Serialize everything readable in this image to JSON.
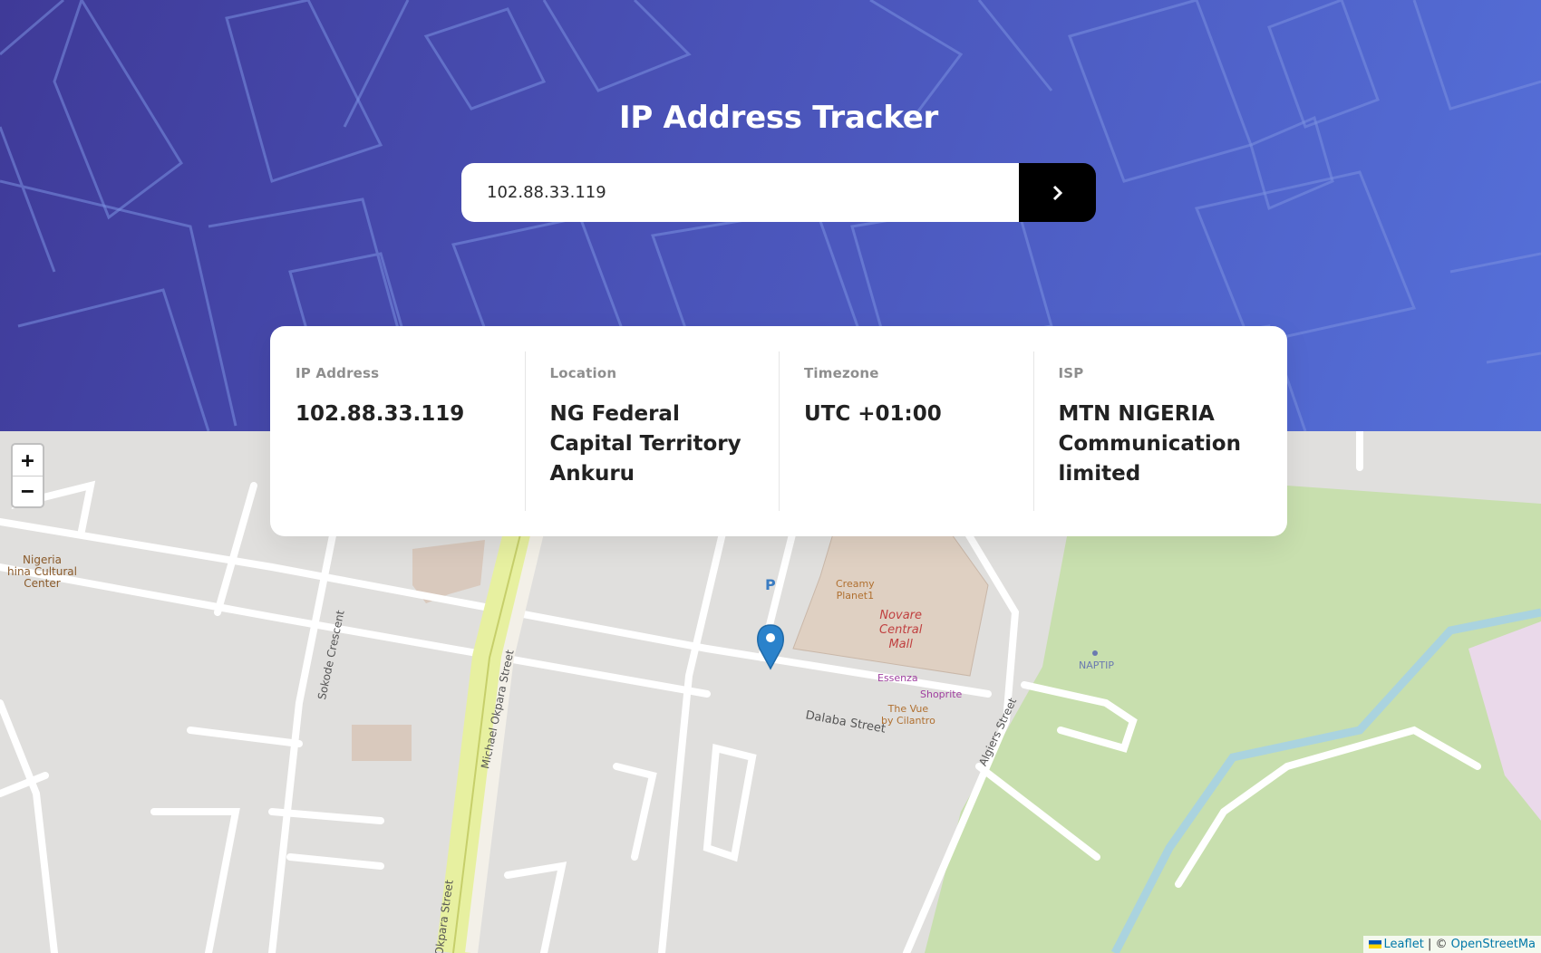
{
  "header": {
    "title": "IP Address Tracker",
    "search_value": "102.88.33.119",
    "submit_icon": "chevron-right-icon"
  },
  "info": {
    "ip": {
      "label": "IP Address",
      "value": "102.88.33.119"
    },
    "location": {
      "label": "Location",
      "value": "NG Federal Capital Territory Ankuru"
    },
    "timezone": {
      "label": "Timezone",
      "value": "UTC +01:00"
    },
    "isp": {
      "label": "ISP",
      "value": "MTN NIGERIA Communication limited"
    }
  },
  "map": {
    "zoom_in": "+",
    "zoom_out": "−",
    "marker_icon": "map-pin-icon",
    "labels": {
      "cultural_center_1": "Nigeria",
      "cultural_center_2": "hina Cultural",
      "cultural_center_3": "Center",
      "street_sokode": "Sokode Crescent",
      "street_okpara": "Michael Okpara Street",
      "street_okpara_2": "Okpara Street",
      "street_dalaba": "Dalaba Street",
      "street_algiers": "Algiers Street",
      "parking": "P",
      "creamy_1": "Creamy",
      "creamy_2": "Planet1",
      "mall_1": "Novare",
      "mall_2": "Central",
      "mall_3": "Mall",
      "essenza": "Essenza",
      "shoprite": "Shoprite",
      "vue_1": "The Vue",
      "vue_2": "by Cilantro",
      "naptip": "NAPTIP"
    },
    "attribution": {
      "leaflet": "Leaflet",
      "separator": " | © ",
      "osm": "OpenStreetMa"
    }
  },
  "colors": {
    "hero_start": "#3f3a98",
    "hero_end": "#5570d9",
    "button": "#000000",
    "park": "#c8dfae",
    "mall": "#dfd0c2"
  }
}
